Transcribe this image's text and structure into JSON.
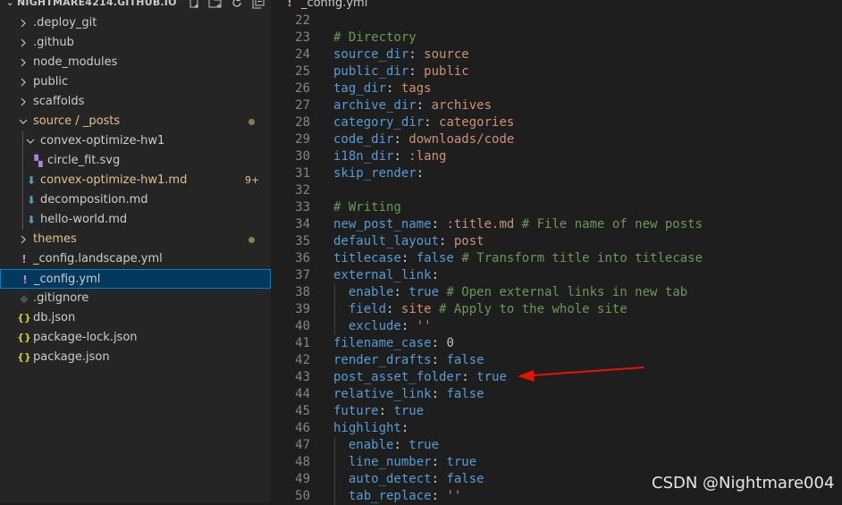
{
  "sidebar": {
    "title": "NIGHTMARE4214.GITHUB.IO",
    "actions": [
      "new-file-icon",
      "new-folder-icon",
      "refresh-icon",
      "collapse-all-icon"
    ],
    "items": [
      {
        "label": ".deploy_git",
        "type": "folder",
        "expanded": false
      },
      {
        "label": ".github",
        "type": "folder",
        "expanded": false
      },
      {
        "label": "node_modules",
        "type": "folder",
        "expanded": false
      },
      {
        "label": "public",
        "type": "folder",
        "expanded": false
      },
      {
        "label": "scaffolds",
        "type": "folder",
        "expanded": false
      },
      {
        "label": "source / _posts",
        "type": "folder",
        "expanded": true,
        "modified": true
      },
      {
        "label": "convex-optimize-hw1",
        "type": "folder",
        "expanded": true
      },
      {
        "label": "circle_fit.svg",
        "type": "svg"
      },
      {
        "label": "convex-optimize-hw1.md",
        "type": "markdown",
        "badge": "9+"
      },
      {
        "label": "decomposition.md",
        "type": "markdown"
      },
      {
        "label": "hello-world.md",
        "type": "markdown"
      },
      {
        "label": "themes",
        "type": "folder",
        "expanded": false,
        "modified": true
      },
      {
        "label": "_config.landscape.yml",
        "type": "yaml"
      },
      {
        "label": "_config.yml",
        "type": "yaml",
        "selected": true
      },
      {
        "label": ".gitignore",
        "type": "git"
      },
      {
        "label": "db.json",
        "type": "json"
      },
      {
        "label": "package-lock.json",
        "type": "json"
      },
      {
        "label": "package.json",
        "type": "json"
      }
    ]
  },
  "editor": {
    "tab_label": "_config.yml",
    "lines": [
      {
        "n": "22",
        "tokens": []
      },
      {
        "n": "23",
        "tokens": [
          [
            "c",
            "# Directory"
          ]
        ]
      },
      {
        "n": "24",
        "tokens": [
          [
            "k",
            "source_dir"
          ],
          [
            "p",
            ": "
          ],
          [
            "v",
            "source"
          ]
        ]
      },
      {
        "n": "25",
        "tokens": [
          [
            "k",
            "public_dir"
          ],
          [
            "p",
            ": "
          ],
          [
            "v",
            "public"
          ]
        ]
      },
      {
        "n": "26",
        "tokens": [
          [
            "k",
            "tag_dir"
          ],
          [
            "p",
            ": "
          ],
          [
            "v",
            "tags"
          ]
        ]
      },
      {
        "n": "27",
        "tokens": [
          [
            "k",
            "archive_dir"
          ],
          [
            "p",
            ": "
          ],
          [
            "v",
            "archives"
          ]
        ]
      },
      {
        "n": "28",
        "tokens": [
          [
            "k",
            "category_dir"
          ],
          [
            "p",
            ": "
          ],
          [
            "v",
            "categories"
          ]
        ]
      },
      {
        "n": "29",
        "tokens": [
          [
            "k",
            "code_dir"
          ],
          [
            "p",
            ": "
          ],
          [
            "v",
            "downloads/code"
          ]
        ]
      },
      {
        "n": "30",
        "tokens": [
          [
            "k",
            "i18n_dir"
          ],
          [
            "p",
            ": "
          ],
          [
            "v",
            ":lang"
          ]
        ]
      },
      {
        "n": "31",
        "tokens": [
          [
            "k",
            "skip_render"
          ],
          [
            "p",
            ":"
          ]
        ]
      },
      {
        "n": "32",
        "tokens": []
      },
      {
        "n": "33",
        "tokens": [
          [
            "c",
            "# Writing"
          ]
        ]
      },
      {
        "n": "34",
        "tokens": [
          [
            "k",
            "new_post_name"
          ],
          [
            "p",
            ": "
          ],
          [
            "v",
            ":title.md "
          ],
          [
            "c",
            "# File name of new posts"
          ]
        ]
      },
      {
        "n": "35",
        "tokens": [
          [
            "k",
            "default_layout"
          ],
          [
            "p",
            ": "
          ],
          [
            "v",
            "post"
          ]
        ]
      },
      {
        "n": "36",
        "tokens": [
          [
            "k",
            "titlecase"
          ],
          [
            "p",
            ": "
          ],
          [
            "b",
            "false"
          ],
          [
            "p",
            " "
          ],
          [
            "c",
            "# Transform title into titlecase"
          ]
        ]
      },
      {
        "n": "37",
        "tokens": [
          [
            "k",
            "external_link"
          ],
          [
            "p",
            ":"
          ]
        ]
      },
      {
        "n": "38",
        "tokens": [
          [
            "p",
            "  "
          ],
          [
            "k",
            "enable"
          ],
          [
            "p",
            ": "
          ],
          [
            "b",
            "true"
          ],
          [
            "p",
            " "
          ],
          [
            "c",
            "# Open external links in new tab"
          ]
        ]
      },
      {
        "n": "39",
        "tokens": [
          [
            "p",
            "  "
          ],
          [
            "k",
            "field"
          ],
          [
            "p",
            ": "
          ],
          [
            "v",
            "site"
          ],
          [
            "p",
            " "
          ],
          [
            "c",
            "# Apply to the whole site"
          ]
        ]
      },
      {
        "n": "40",
        "tokens": [
          [
            "p",
            "  "
          ],
          [
            "k",
            "exclude"
          ],
          [
            "p",
            ": "
          ],
          [
            "v",
            "''"
          ]
        ]
      },
      {
        "n": "41",
        "tokens": [
          [
            "k",
            "filename_case"
          ],
          [
            "p",
            ": "
          ],
          [
            "n",
            "0"
          ]
        ]
      },
      {
        "n": "42",
        "tokens": [
          [
            "k",
            "render_drafts"
          ],
          [
            "p",
            ": "
          ],
          [
            "b",
            "false"
          ]
        ]
      },
      {
        "n": "43",
        "tokens": [
          [
            "k",
            "post_asset_folder"
          ],
          [
            "p",
            ": "
          ],
          [
            "b",
            "true"
          ]
        ]
      },
      {
        "n": "44",
        "tokens": [
          [
            "k",
            "relative_link"
          ],
          [
            "p",
            ": "
          ],
          [
            "b",
            "false"
          ]
        ]
      },
      {
        "n": "45",
        "tokens": [
          [
            "k",
            "future"
          ],
          [
            "p",
            ": "
          ],
          [
            "b",
            "true"
          ]
        ]
      },
      {
        "n": "46",
        "tokens": [
          [
            "k",
            "highlight"
          ],
          [
            "p",
            ":"
          ]
        ]
      },
      {
        "n": "47",
        "tokens": [
          [
            "p",
            "  "
          ],
          [
            "k",
            "enable"
          ],
          [
            "p",
            ": "
          ],
          [
            "b",
            "true"
          ]
        ]
      },
      {
        "n": "48",
        "tokens": [
          [
            "p",
            "  "
          ],
          [
            "k",
            "line_number"
          ],
          [
            "p",
            ": "
          ],
          [
            "b",
            "true"
          ]
        ]
      },
      {
        "n": "49",
        "tokens": [
          [
            "p",
            "  "
          ],
          [
            "k",
            "auto_detect"
          ],
          [
            "p",
            ": "
          ],
          [
            "b",
            "false"
          ]
        ]
      },
      {
        "n": "50",
        "tokens": [
          [
            "p",
            "  "
          ],
          [
            "k",
            "tab_replace"
          ],
          [
            "p",
            ": "
          ],
          [
            "v",
            "''"
          ]
        ]
      }
    ]
  },
  "annotation": {
    "arrow_color": "#e51400"
  },
  "watermark": "CSDN @Nightmare004",
  "colors": {
    "folder_modified": "#e2c08d",
    "modified_dot": "#8c7d4c",
    "markdown_icon": "#519aba",
    "yaml_icon": "#c586c0",
    "json_icon": "#cbcb41",
    "selection_border": "#007fd4"
  }
}
